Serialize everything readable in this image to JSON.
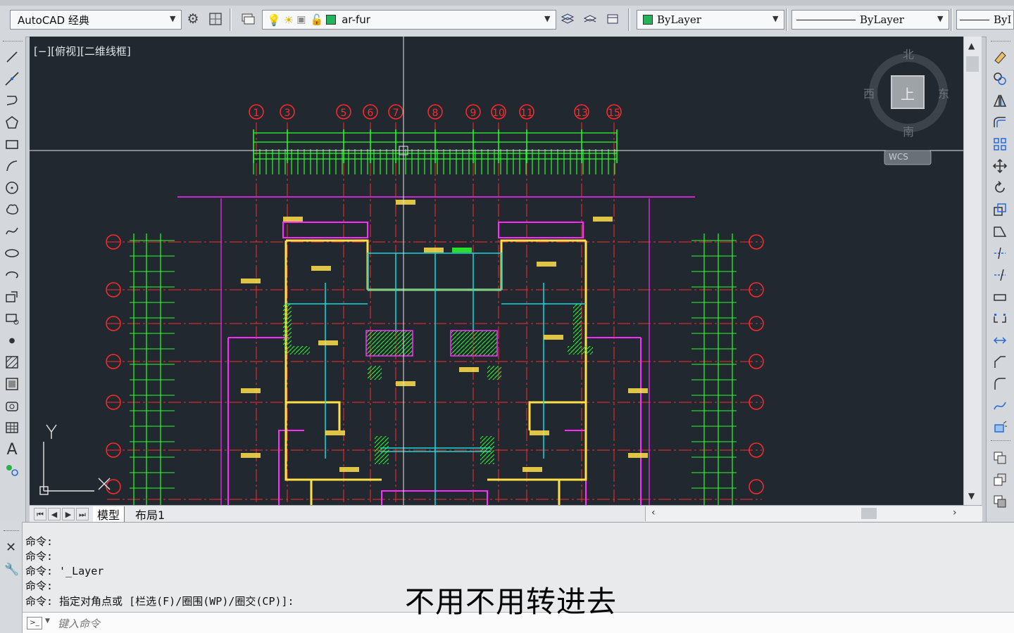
{
  "toolbar": {
    "workspace": "AutoCAD 经典",
    "layer": "ar-fur",
    "color": "ByLayer",
    "linetype": "ByLayer",
    "lineweight": "ByI"
  },
  "viewport": {
    "label": "[−][俯视][二维线框]",
    "viewcube": {
      "north": "北",
      "south": "南",
      "east": "东",
      "west": "西",
      "face": "上",
      "wcs": "WCS"
    }
  },
  "tabs": {
    "model": "模型",
    "layout": "布局1"
  },
  "command": {
    "history": [
      "命令:",
      "命令:",
      "命令: '_Layer",
      "命令:",
      "命令: 指定对角点或 [栏选(F)/圈围(WP)/圈交(CP)]:"
    ],
    "placeholder": "键入命令"
  },
  "subtitle": "不用不用转进去",
  "drawing": {
    "axis_labels": [
      "1",
      "3",
      "5",
      "6",
      "7",
      "8",
      "9",
      "10",
      "11",
      "13",
      "15"
    ],
    "colors": {
      "background": "#212830",
      "axis": "#ff2a2a",
      "dimension": "#2bff2b",
      "wall": "#ffe04a",
      "outline": "#ff2bff",
      "structure": "#19d7d7"
    }
  }
}
